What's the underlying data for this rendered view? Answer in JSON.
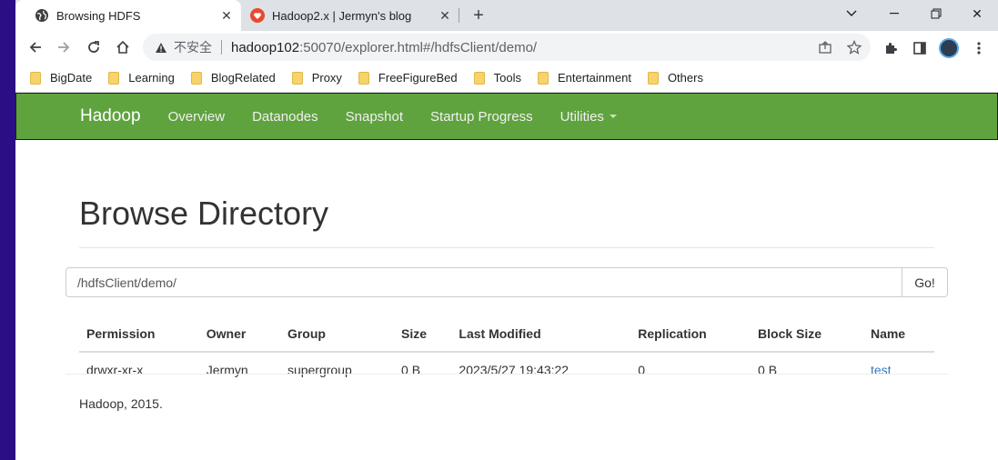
{
  "tabs": [
    {
      "title": "Browsing HDFS",
      "favicon": "globe-icon"
    },
    {
      "title": "Hadoop2.x | Jermyn's blog",
      "favicon": "heart-icon",
      "favicon_color": "#e8492f"
    }
  ],
  "address_bar": {
    "security_label": "不安全",
    "url_host": "hadoop102",
    "url_rest": ":50070/explorer.html#/hdfsClient/demo/"
  },
  "bookmarks": [
    "BigDate",
    "Learning",
    "BlogRelated",
    "Proxy",
    "FreeFigureBed",
    "Tools",
    "Entertainment",
    "Others"
  ],
  "navbar": {
    "brand": "Hadoop",
    "links": [
      "Overview",
      "Datanodes",
      "Snapshot",
      "Startup Progress",
      "Utilities"
    ],
    "color": "#5fa33e"
  },
  "page": {
    "title": "Browse Directory",
    "path_value": "/hdfsClient/demo/",
    "go_label": "Go!"
  },
  "table": {
    "headers": [
      "Permission",
      "Owner",
      "Group",
      "Size",
      "Last Modified",
      "Replication",
      "Block Size",
      "Name"
    ],
    "rows": [
      [
        "drwxr-xr-x",
        "Jermyn",
        "supergroup",
        "0 B",
        "2023/5/27 19:43:22",
        "0",
        "0 B",
        "test"
      ]
    ]
  },
  "footer": "Hadoop, 2015."
}
